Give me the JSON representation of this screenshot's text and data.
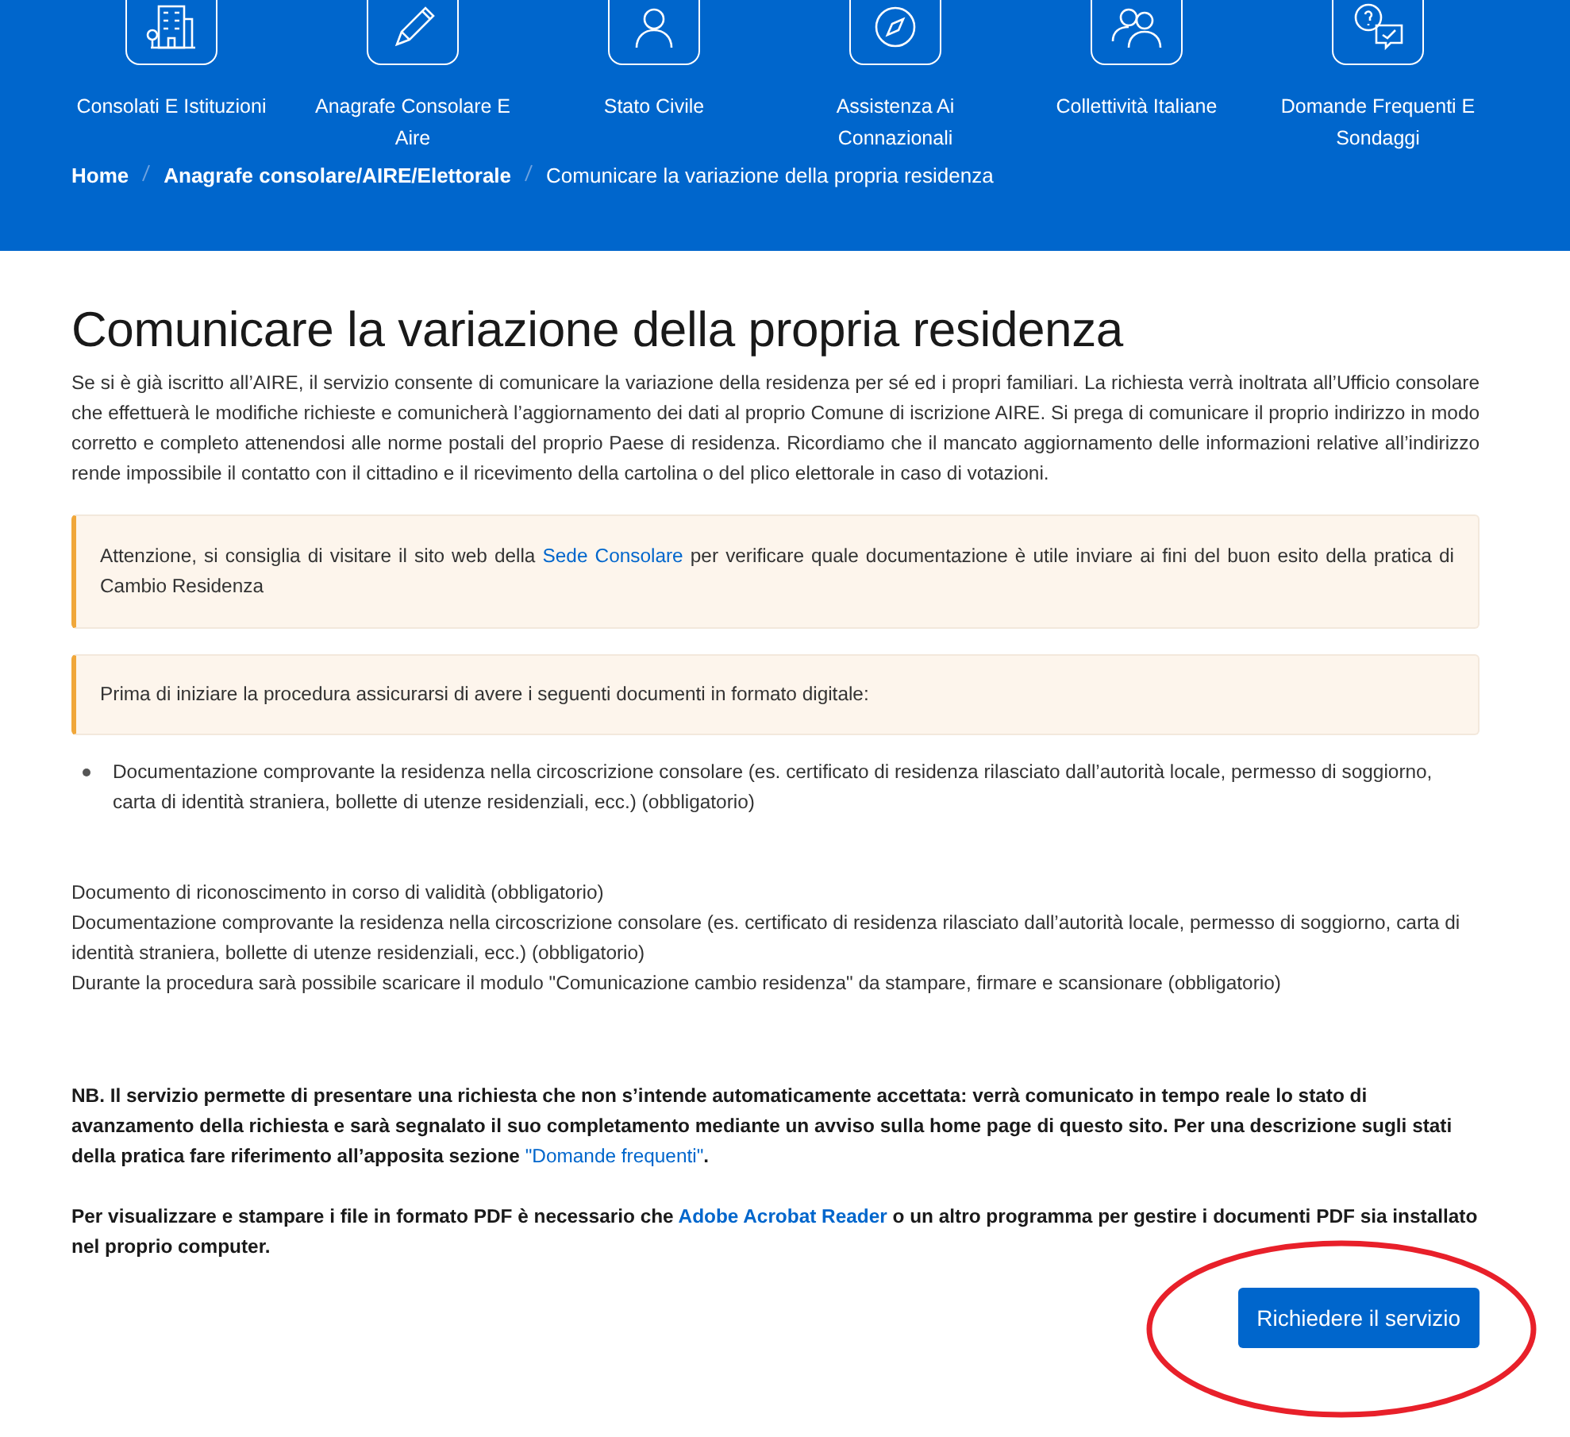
{
  "nav": [
    {
      "label": "Consolati E Istituzioni"
    },
    {
      "label": "Anagrafe Consolare E Aire"
    },
    {
      "label": "Stato Civile"
    },
    {
      "label": "Assistenza Ai Connazionali"
    },
    {
      "label": "Collettività Italiane"
    },
    {
      "label": "Domande Frequenti E Sondaggi"
    }
  ],
  "breadcrumb": [
    {
      "label": "Home",
      "current": false
    },
    {
      "label": "Anagrafe consolare/AIRE/Elettorale",
      "current": false
    },
    {
      "label": "Comunicare la variazione della propria residenza",
      "current": true
    }
  ],
  "title": "Comunicare la variazione della propria residenza",
  "intro": "Se si è già iscritto all’AIRE, il servizio consente di comunicare la variazione della residenza per sé ed i propri familiari. La richiesta verrà inoltrata all’Ufficio consolare che effettuerà le modifiche richieste e comunicherà l’aggiornamento dei dati al proprio Comune di iscrizione AIRE. Si prega di comunicare il proprio indirizzo in modo corretto e completo attenendosi alle norme postali del proprio Paese di residenza. Ricordiamo che il mancato aggiornamento delle informazioni relative all’indirizzo rende impossibile il contatto con il cittadino e il ricevimento della cartolina o del plico elettorale in caso di votazioni.",
  "alerts": [
    {
      "before": "Attenzione, si consiglia di visitare il sito web della ",
      "link": "Sede Consolare",
      "after": " per verificare quale documentazione è utile inviare ai fini del buon esito della pratica di Cambio Residenza"
    },
    {
      "before": "Prima di iniziare la procedura assicurarsi di avere i seguenti documenti in formato digitale:"
    }
  ],
  "bullets": [
    "Documentazione comprovante la residenza nella circoscrizione consolare (es. certificato di residenza rilasciato dall’autorità locale, permesso di soggiorno, carta di identità straniera, bollette di utenze residenziali, ecc.) (obbligatorio)"
  ],
  "documents": [
    "Documento di riconoscimento in corso di validità (obbligatorio)",
    "Documentazione comprovante la residenza nella circoscrizione consolare (es. certificato di residenza rilasciato dall’autorità locale, permesso di soggiorno, carta di identità straniera, bollette di utenze residenziali, ecc.) (obbligatorio)",
    "Durante la procedura sarà possibile scaricare il modulo \"Comunicazione cambio residenza\" da stampare, firmare e scansionare (obbligatorio)"
  ],
  "notes": [
    {
      "before": "NB. Il servizio permette di presentare una richiesta che non s’intende automaticamente accettata: verrà comunicato in tempo reale lo stato di avanzamento della richiesta e sarà segnalato il suo completamento mediante un avviso sulla home page di questo sito. Per una descrizione sugli stati della pratica fare riferimento all’apposita sezione ",
      "link": "\"Domande frequenti\"",
      "link_bold": false,
      "after": "."
    },
    {
      "before": "Per visualizzare e stampare i file in formato PDF è necessario che ",
      "link": "Adobe Acrobat Reader",
      "link_bold": true,
      "after": " o un altro programma per gestire i documenti PDF sia installato nel proprio computer."
    }
  ],
  "button": "Richiedere il servizio",
  "annotation": {
    "kind": "ellipse"
  }
}
